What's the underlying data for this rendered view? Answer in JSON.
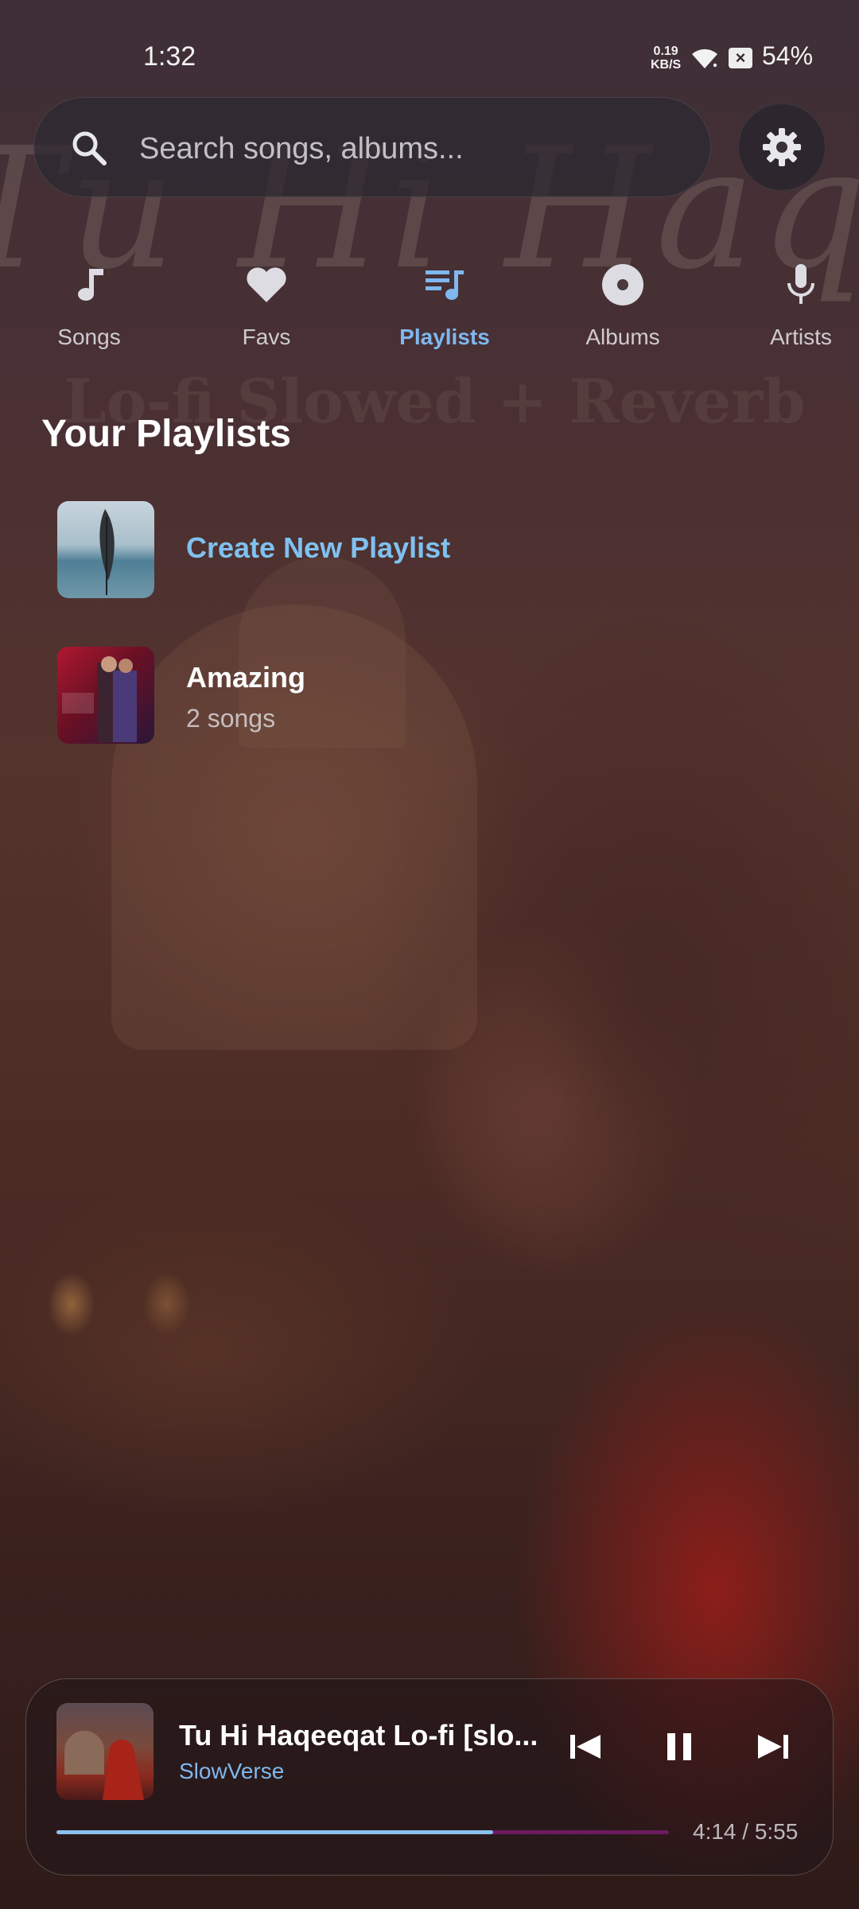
{
  "status_bar": {
    "time": "1:32",
    "net_speed_value": "0.19",
    "net_speed_unit": "KB/S",
    "battery": "54%"
  },
  "search": {
    "placeholder": "Search songs, albums..."
  },
  "background": {
    "title_art_text": "Tu Hi Haqeeqat",
    "sub_art_text": "Lo-fi Slowed + Reverb"
  },
  "tabs": [
    {
      "label": "Songs",
      "icon": "music-note-icon",
      "active": false
    },
    {
      "label": "Favs",
      "icon": "heart-icon",
      "active": false
    },
    {
      "label": "Playlists",
      "icon": "playlist-icon",
      "active": true
    },
    {
      "label": "Albums",
      "icon": "album-disc-icon",
      "active": false
    },
    {
      "label": "Artists",
      "icon": "microphone-icon",
      "active": false
    }
  ],
  "section_title": "Your Playlists",
  "playlists": {
    "create_label": "Create New Playlist",
    "items": [
      {
        "name": "Amazing",
        "count": "2 songs"
      }
    ]
  },
  "player": {
    "title": "Tu Hi Haqeeqat Lo-fi [slo...",
    "artist": "SlowVerse",
    "time": "4:14 / 5:55",
    "progress_fraction": 0.713,
    "state": "playing"
  },
  "colors": {
    "accent": "#7fb8ef",
    "progress_remaining": "#82207a"
  }
}
